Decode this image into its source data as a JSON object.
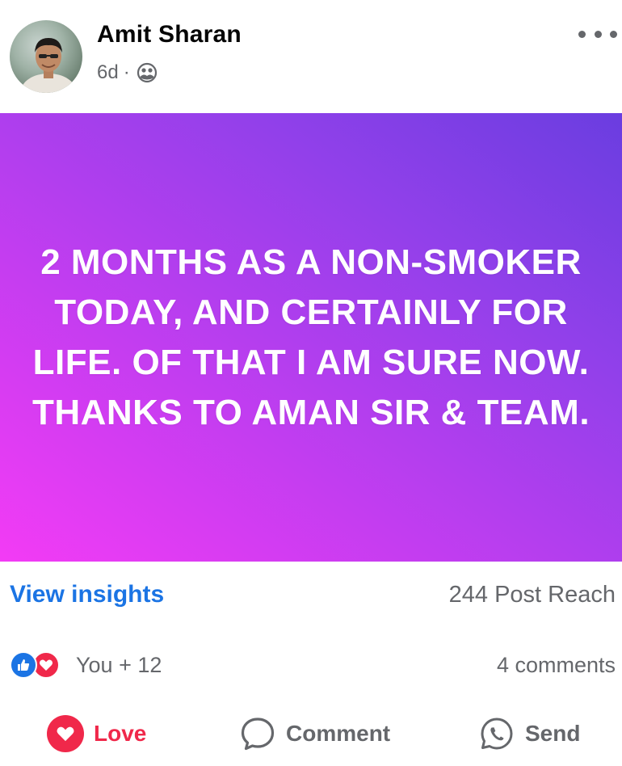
{
  "header": {
    "author_name": "Amit Sharan",
    "time_ago": "6d",
    "separator": "·",
    "audience_icon": "friends-icon",
    "more_icon": "more-horizontal-icon"
  },
  "post": {
    "text": "2 MONTHS AS A NON-SMOKER TODAY, AND CERTAINLY FOR LIFE. OF THAT I AM SURE NOW. THANKS TO AMAN SIR & TEAM.",
    "background_colors": [
      "#f33bf5",
      "#6a3de0"
    ]
  },
  "insights": {
    "link_label": "View insights",
    "reach_label": "244 Post Reach"
  },
  "reactions": {
    "icons": [
      "like-icon",
      "love-icon"
    ],
    "summary": "You + 12",
    "comments_label": "4 comments"
  },
  "actions": {
    "love_label": "Love",
    "comment_label": "Comment",
    "send_label": "Send"
  },
  "colors": {
    "link_blue": "#1b74e4",
    "love_red": "#f0284a",
    "secondary_text": "#65676b"
  }
}
